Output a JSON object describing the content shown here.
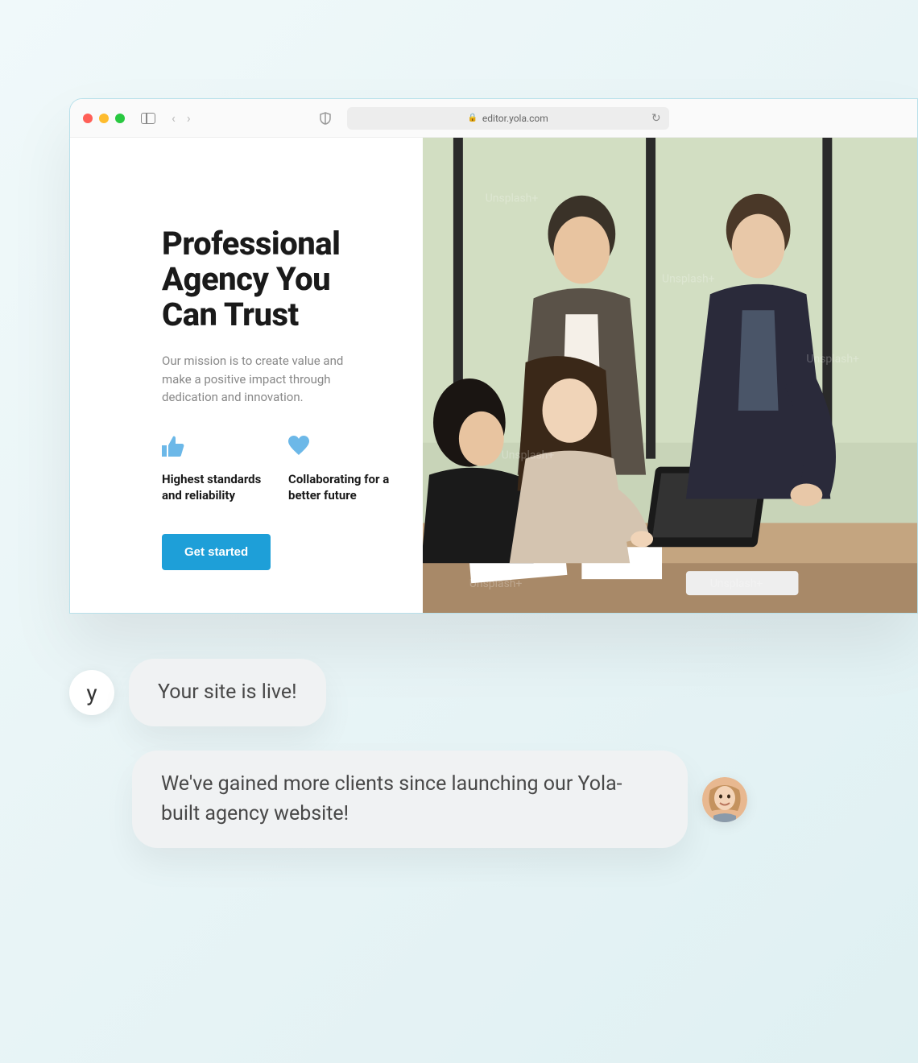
{
  "browser": {
    "url": "editor.yola.com"
  },
  "hero": {
    "title": "Professional Agency You Can Trust",
    "subtitle": "Our mission is to create value and make a positive impact through dedication and innovation.",
    "cta_label": "Get started"
  },
  "features": [
    {
      "icon": "thumbs-up",
      "text": "Highest standards and reliability"
    },
    {
      "icon": "heart",
      "text": "Collaborating for a better future"
    }
  ],
  "chat": {
    "bot_avatar_letter": "y",
    "message1": "Your site is live!",
    "message2": "We've gained more clients since launching our Yola-built agency website!"
  },
  "colors": {
    "accent": "#1e9fd8",
    "icon_blue": "#6cb8e8"
  }
}
